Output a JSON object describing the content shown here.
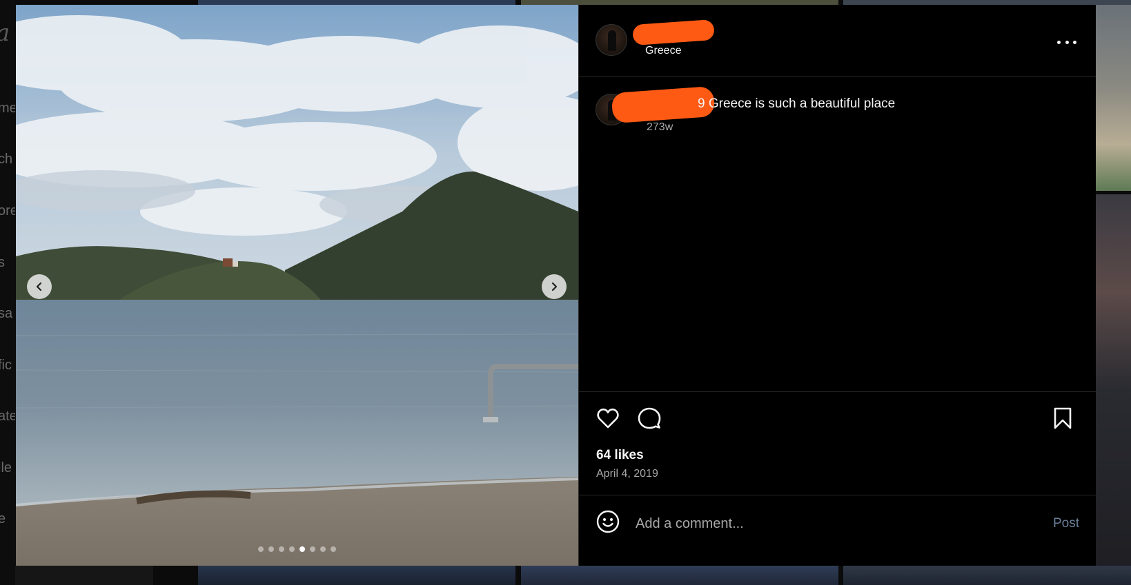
{
  "background": {
    "logo_fragment": "a",
    "nav_fragments": [
      "me",
      "ch",
      "ore",
      "s",
      "sa",
      "fic",
      "ate",
      "ile",
      "e"
    ]
  },
  "media": {
    "carousel": {
      "total": 8,
      "active_index": 4
    },
    "prev_icon": "chevron-left-icon",
    "next_icon": "chevron-right-icon"
  },
  "post": {
    "header": {
      "location": "Greece",
      "more_icon": "ellipsis-icon"
    },
    "caption": {
      "visible_text": "9 Greece is such a beautiful place",
      "age": "273w"
    },
    "likes": "64 likes",
    "date": "April 4, 2019",
    "comment": {
      "placeholder": "Add a comment...",
      "post_label": "Post"
    },
    "icons": {
      "like": "heart-icon",
      "comment": "speech-bubble-icon",
      "save": "bookmark-icon",
      "emoji": "smiley-icon"
    }
  },
  "colors": {
    "redaction": "#ff5a14",
    "panel_bg": "#000000",
    "post_button": "#6a7f99"
  }
}
